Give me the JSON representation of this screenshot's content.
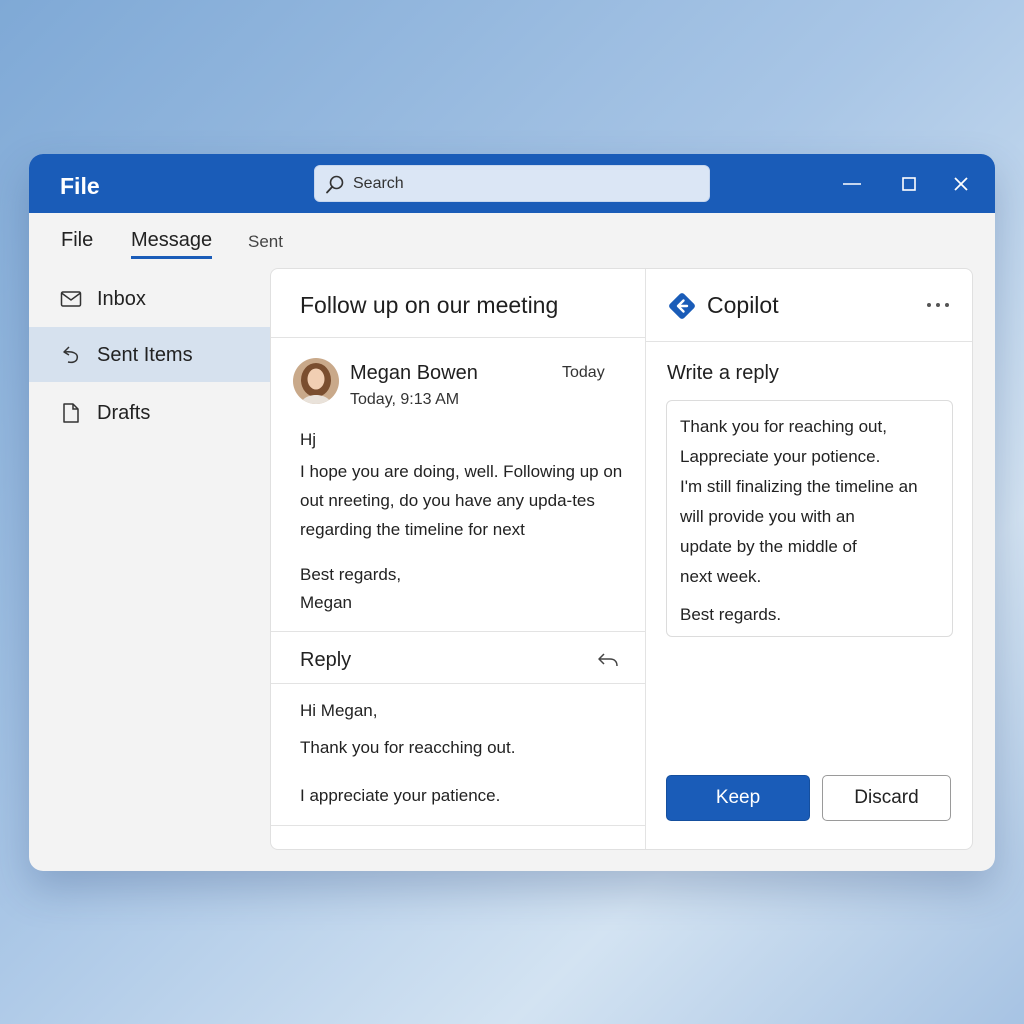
{
  "app": {
    "title": "File"
  },
  "search": {
    "placeholder": "Search"
  },
  "window_controls": {
    "minimize": "minimize-icon",
    "maximize": "maximize-icon",
    "close": "close-icon"
  },
  "menu": {
    "items": [
      "File",
      "Message"
    ],
    "active": "Message",
    "context": "Sent"
  },
  "sidebar": {
    "items": [
      {
        "label": "Inbox",
        "icon": "mail-icon"
      },
      {
        "label": "Sent Items",
        "icon": "sent-icon",
        "selected": true
      },
      {
        "label": "Drafts",
        "icon": "draft-icon"
      }
    ]
  },
  "email": {
    "subject": "Follow up on our meeting",
    "sender": "Megan Bowen",
    "date_label": "Today",
    "sent_time": "Today, 9:13 AM",
    "greeting": "Hj",
    "body": "I hope you are doing, well. Following up on out nreeting, do you have any upda-tes regarding the timeline for next",
    "closing": "Best regards,",
    "signature": "Megan"
  },
  "reply": {
    "label": "Reply",
    "lines": [
      "Hi Megan,",
      "Thank you for reacching out.",
      "I appreciate your patience."
    ]
  },
  "copilot": {
    "title": "Copilot",
    "section_title": "Write a reply",
    "draft_lines": [
      "Thank you for reaching out,",
      "Lappreciate your potience.",
      "I'm still finalizing the timeline an",
      "will provide you with an",
      "update by the middle of",
      "next week.",
      "Best regards."
    ],
    "keep_label": "Keep",
    "discard_label": "Discard"
  },
  "colors": {
    "accent": "#1a5cb8",
    "selected_nav": "#d6e1ee",
    "window_bg": "#f3f3f3"
  }
}
